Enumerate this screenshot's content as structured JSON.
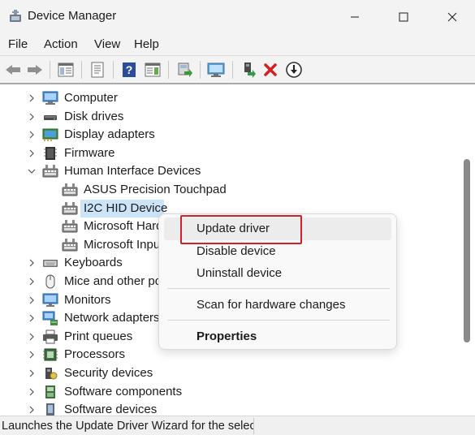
{
  "window": {
    "title": "Device Manager",
    "controls": [
      "minimize",
      "maximize",
      "close"
    ]
  },
  "menubar": {
    "items": [
      "File",
      "Action",
      "View",
      "Help"
    ]
  },
  "toolbar": {
    "buttons": [
      "back-icon",
      "forward-icon",
      "show-hide-console-tree-icon",
      "properties-icon",
      "help-icon",
      "action-pane-icon",
      "scan-hardware-icon",
      "monitor-icon",
      "enable-device-icon",
      "uninstall-x-icon",
      "update-driver-icon"
    ],
    "colors": {
      "uninstall": "#d32027",
      "help": "#2b4c9a"
    }
  },
  "tree": {
    "rows": [
      {
        "label": "Computer",
        "level": 1,
        "expander": "collapsed",
        "icon": "computer-icon"
      },
      {
        "label": "Disk drives",
        "level": 1,
        "expander": "collapsed",
        "icon": "disk-drive-icon"
      },
      {
        "label": "Display adapters",
        "level": 1,
        "expander": "collapsed",
        "icon": "display-adapter-icon"
      },
      {
        "label": "Firmware",
        "level": 1,
        "expander": "collapsed",
        "icon": "firmware-icon"
      },
      {
        "label": "Human Interface Devices",
        "level": 1,
        "expander": "expanded",
        "icon": "hid-icon"
      },
      {
        "label": "ASUS Precision Touchpad",
        "level": 2,
        "expander": "none",
        "icon": "hid-icon"
      },
      {
        "label": "I2C HID Device",
        "level": 2,
        "expander": "none",
        "icon": "hid-icon",
        "selected": true
      },
      {
        "label": "Microsoft Hard",
        "level": 2,
        "expander": "none",
        "icon": "hid-icon"
      },
      {
        "label": "Microsoft Inpu",
        "level": 2,
        "expander": "none",
        "icon": "hid-icon"
      },
      {
        "label": "Keyboards",
        "level": 1,
        "expander": "collapsed",
        "icon": "keyboard-icon"
      },
      {
        "label": "Mice and other po",
        "level": 1,
        "expander": "collapsed",
        "icon": "mouse-icon"
      },
      {
        "label": "Monitors",
        "level": 1,
        "expander": "collapsed",
        "icon": "monitor-icon"
      },
      {
        "label": "Network adapters",
        "level": 1,
        "expander": "collapsed",
        "icon": "network-adapter-icon"
      },
      {
        "label": "Print queues",
        "level": 1,
        "expander": "collapsed",
        "icon": "printer-icon"
      },
      {
        "label": "Processors",
        "level": 1,
        "expander": "collapsed",
        "icon": "processor-icon"
      },
      {
        "label": "Security devices",
        "level": 1,
        "expander": "collapsed",
        "icon": "security-device-icon"
      },
      {
        "label": "Software components",
        "level": 1,
        "expander": "collapsed",
        "icon": "software-component-icon"
      },
      {
        "label": "Software devices",
        "level": 1,
        "expander": "collapsed",
        "icon": "software-device-icon"
      }
    ]
  },
  "context_menu": {
    "items": [
      {
        "label": "Update driver",
        "hovered": true,
        "highlighted": true
      },
      {
        "label": "Disable device"
      },
      {
        "label": "Uninstall device"
      },
      {
        "label": "Scan for hardware changes"
      },
      {
        "label": "Properties",
        "bold": true
      }
    ],
    "highlight_color": "#d32027"
  },
  "statusbar": {
    "text": "Launches the Update Driver Wizard for the selec"
  },
  "colors": {
    "selection": "#cce4f7",
    "scroll_thumb": "#8a8a8a"
  }
}
